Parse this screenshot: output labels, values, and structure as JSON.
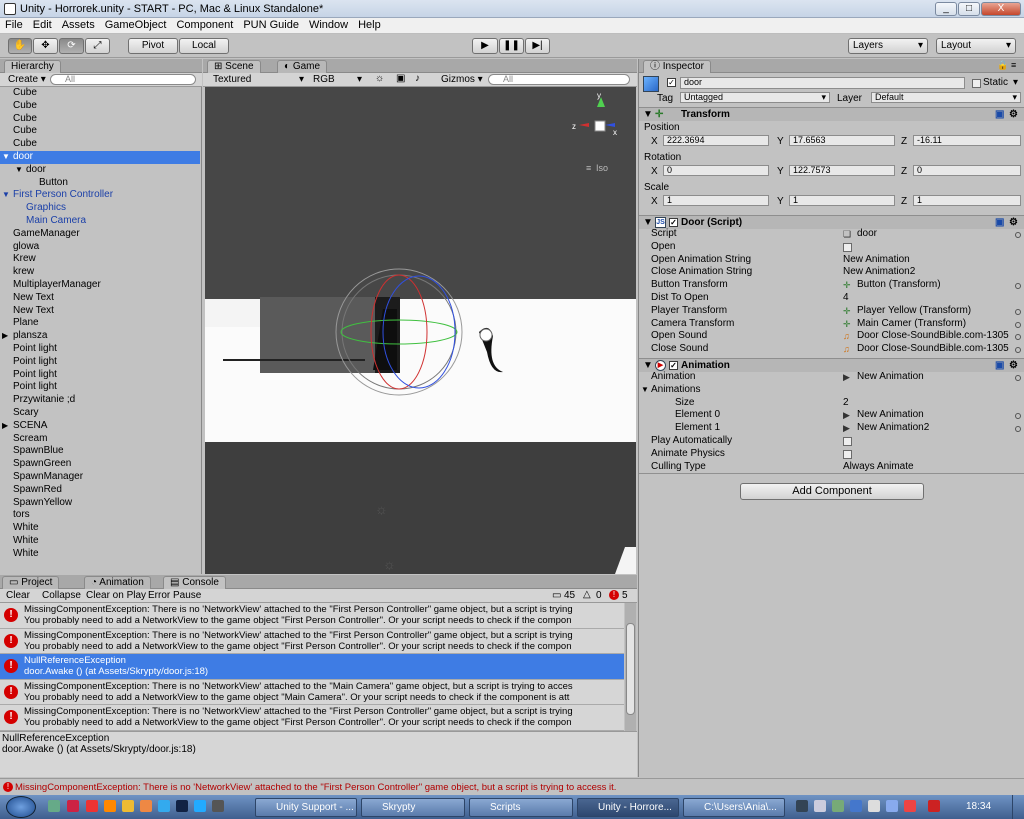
{
  "window": {
    "title": "Unity - Horrorek.unity - START - PC, Mac & Linux Standalone*",
    "min": "_",
    "max": "□",
    "close": "X"
  },
  "menu": [
    "File",
    "Edit",
    "Assets",
    "GameObject",
    "Component",
    "PUN Guide",
    "Window",
    "Help"
  ],
  "toolbar": {
    "pivot": "Pivot",
    "local": "Local",
    "layers": "Layers",
    "layout": "Layout",
    "play": "▶",
    "pause": "❚❚",
    "step": "▶|"
  },
  "hierarchy": {
    "tab": "Hierarchy",
    "create": "Create",
    "search_placeholder": "All",
    "items": [
      {
        "label": "Cube",
        "indent": 0
      },
      {
        "label": "Cube",
        "indent": 0
      },
      {
        "label": "Cube",
        "indent": 0
      },
      {
        "label": "Cube",
        "indent": 0
      },
      {
        "label": "Cube",
        "indent": 0
      },
      {
        "label": "door",
        "indent": 0,
        "arrow": "▼",
        "selected": true
      },
      {
        "label": "door",
        "indent": 1,
        "arrow": "▼"
      },
      {
        "label": "Button",
        "indent": 2
      },
      {
        "label": "First Person Controller",
        "indent": 0,
        "arrow": "▼",
        "blue": true
      },
      {
        "label": "Graphics",
        "indent": 1,
        "blue": true
      },
      {
        "label": "Main Camera",
        "indent": 1,
        "blue": true
      },
      {
        "label": "GameManager",
        "indent": 0
      },
      {
        "label": "glowa",
        "indent": 0
      },
      {
        "label": "Krew",
        "indent": 0
      },
      {
        "label": "krew",
        "indent": 0
      },
      {
        "label": "MultiplayerManager",
        "indent": 0
      },
      {
        "label": "New Text",
        "indent": 0
      },
      {
        "label": "New Text",
        "indent": 0
      },
      {
        "label": "Plane",
        "indent": 0
      },
      {
        "label": "plansza",
        "indent": 0,
        "arrow": "▶"
      },
      {
        "label": "Point light",
        "indent": 0
      },
      {
        "label": "Point light",
        "indent": 0
      },
      {
        "label": "Point light",
        "indent": 0
      },
      {
        "label": "Point light",
        "indent": 0
      },
      {
        "label": "Przywitanie ;d",
        "indent": 0
      },
      {
        "label": "Scary",
        "indent": 0
      },
      {
        "label": "SCENA",
        "indent": 0,
        "arrow": "▶"
      },
      {
        "label": "Scream",
        "indent": 0
      },
      {
        "label": "SpawnBlue",
        "indent": 0
      },
      {
        "label": "SpawnGreen",
        "indent": 0
      },
      {
        "label": "SpawnManager",
        "indent": 0
      },
      {
        "label": "SpawnRed",
        "indent": 0
      },
      {
        "label": "SpawnYellow",
        "indent": 0
      },
      {
        "label": "tors",
        "indent": 0
      },
      {
        "label": "White",
        "indent": 0
      },
      {
        "label": "White",
        "indent": 0
      },
      {
        "label": "White",
        "indent": 0
      }
    ]
  },
  "scene": {
    "tab_scene": "Scene",
    "tab_game": "Game",
    "render_mode": "Textured",
    "color_mode": "RGB",
    "gizmos": "Gizmos",
    "search_placeholder": "All",
    "iso": "Iso",
    "axis_y": "y",
    "axis_x": "x",
    "axis_z": "z"
  },
  "inspector": {
    "tab": "Inspector",
    "object_name": "door",
    "static": "Static",
    "tag_label": "Tag",
    "tag_value": "Untagged",
    "layer_label": "Layer",
    "layer_value": "Default",
    "transform": {
      "title": "Transform",
      "position": "Position",
      "rotation": "Rotation",
      "scale": "Scale",
      "pos": [
        "222.3694",
        "17.6563",
        "-16.11"
      ],
      "rot": [
        "0",
        "122.7573",
        "0"
      ],
      "scl": [
        "1",
        "1",
        "1"
      ],
      "x": "X",
      "y": "Y",
      "z": "Z"
    },
    "door_script": {
      "title": "Door (Script)",
      "rows": [
        {
          "label": "Script",
          "value": "door",
          "icon": "script"
        },
        {
          "label": "Open",
          "value": "",
          "icon": "checkbox"
        },
        {
          "label": "Open Animation String",
          "value": "New Animation"
        },
        {
          "label": "Close Animation String",
          "value": "New Animation2"
        },
        {
          "label": "Button Transform",
          "value": "Button (Transform)",
          "icon": "transform"
        },
        {
          "label": "Dist To Open",
          "value": "4"
        },
        {
          "label": "Player Transform",
          "value": "Player Yellow (Transform)",
          "icon": "transform"
        },
        {
          "label": "Camera Transform",
          "value": "Main Camer (Transform)",
          "icon": "transform"
        },
        {
          "label": "Open Sound",
          "value": "Door Close-SoundBible.com-1305",
          "icon": "audio"
        },
        {
          "label": "Close Sound",
          "value": "Door Close-SoundBible.com-1305",
          "icon": "audio"
        }
      ]
    },
    "animation": {
      "title": "Animation",
      "rows": [
        {
          "label": "Animation",
          "value": "New Animation",
          "icon": "anim",
          "indent": 0
        },
        {
          "label": "Animations",
          "value": "",
          "indent": 0,
          "arrow": "▼"
        },
        {
          "label": "Size",
          "value": "2",
          "indent": 2
        },
        {
          "label": "Element 0",
          "value": "New Animation",
          "icon": "anim",
          "indent": 2
        },
        {
          "label": "Element 1",
          "value": "New Animation2",
          "icon": "anim",
          "indent": 2
        },
        {
          "label": "Play Automatically",
          "value": "",
          "icon": "checkbox",
          "indent": 0
        },
        {
          "label": "Animate Physics",
          "value": "",
          "icon": "checkbox",
          "indent": 0
        },
        {
          "label": "Culling Type",
          "value": "Always Animate",
          "indent": 0
        }
      ]
    },
    "add_component": "Add Component"
  },
  "bottom": {
    "tabs": [
      "Project",
      "Animation",
      "Console"
    ],
    "buttons": [
      "Clear",
      "Collapse",
      "Clear on Play",
      "Error Pause"
    ],
    "counts": {
      "log": "45",
      "warn": "0",
      "err": "5"
    },
    "entries": [
      {
        "l1": "MissingComponentException: There is no 'NetworkView' attached to the \"First Person Controller\" game object, but a script is trying",
        "l2": "You probably need to add a NetworkView to the game object \"First Person Controller\". Or your script needs to check if the compon"
      },
      {
        "l1": "MissingComponentException: There is no 'NetworkView' attached to the \"First Person Controller\" game object, but a script is trying",
        "l2": "You probably need to add a NetworkView to the game object \"First Person Controller\". Or your script needs to check if the compon"
      },
      {
        "l1": "NullReferenceException",
        "l2": "door.Awake () (at Assets/Skrypty/door.js:18)",
        "selected": true
      },
      {
        "l1": "MissingComponentException: There is no 'NetworkView' attached to the \"Main Camera\" game object, but a script is trying to acces",
        "l2": "You probably need to add a NetworkView to the game object \"Main Camera\". Or your script needs to check if the component is att"
      },
      {
        "l1": "MissingComponentException: There is no 'NetworkView' attached to the \"First Person Controller\" game object, but a script is trying",
        "l2": "You probably need to add a NetworkView to the game object \"First Person Controller\". Or your script needs to check if the compon"
      }
    ],
    "detail1": "NullReferenceException",
    "detail2": "door.Awake () (at Assets/Skrypty/door.js:18)"
  },
  "status": "MissingComponentException: There is no 'NetworkView' attached to the \"First Person Controller\" game object, but a script is trying to access it.",
  "taskbar": {
    "items": [
      "Unity Support - ...",
      "Skrypty",
      "Scripts",
      "Unity - Horrore...",
      "C:\\Users\\Ania\\..."
    ],
    "clock": "18:34"
  }
}
